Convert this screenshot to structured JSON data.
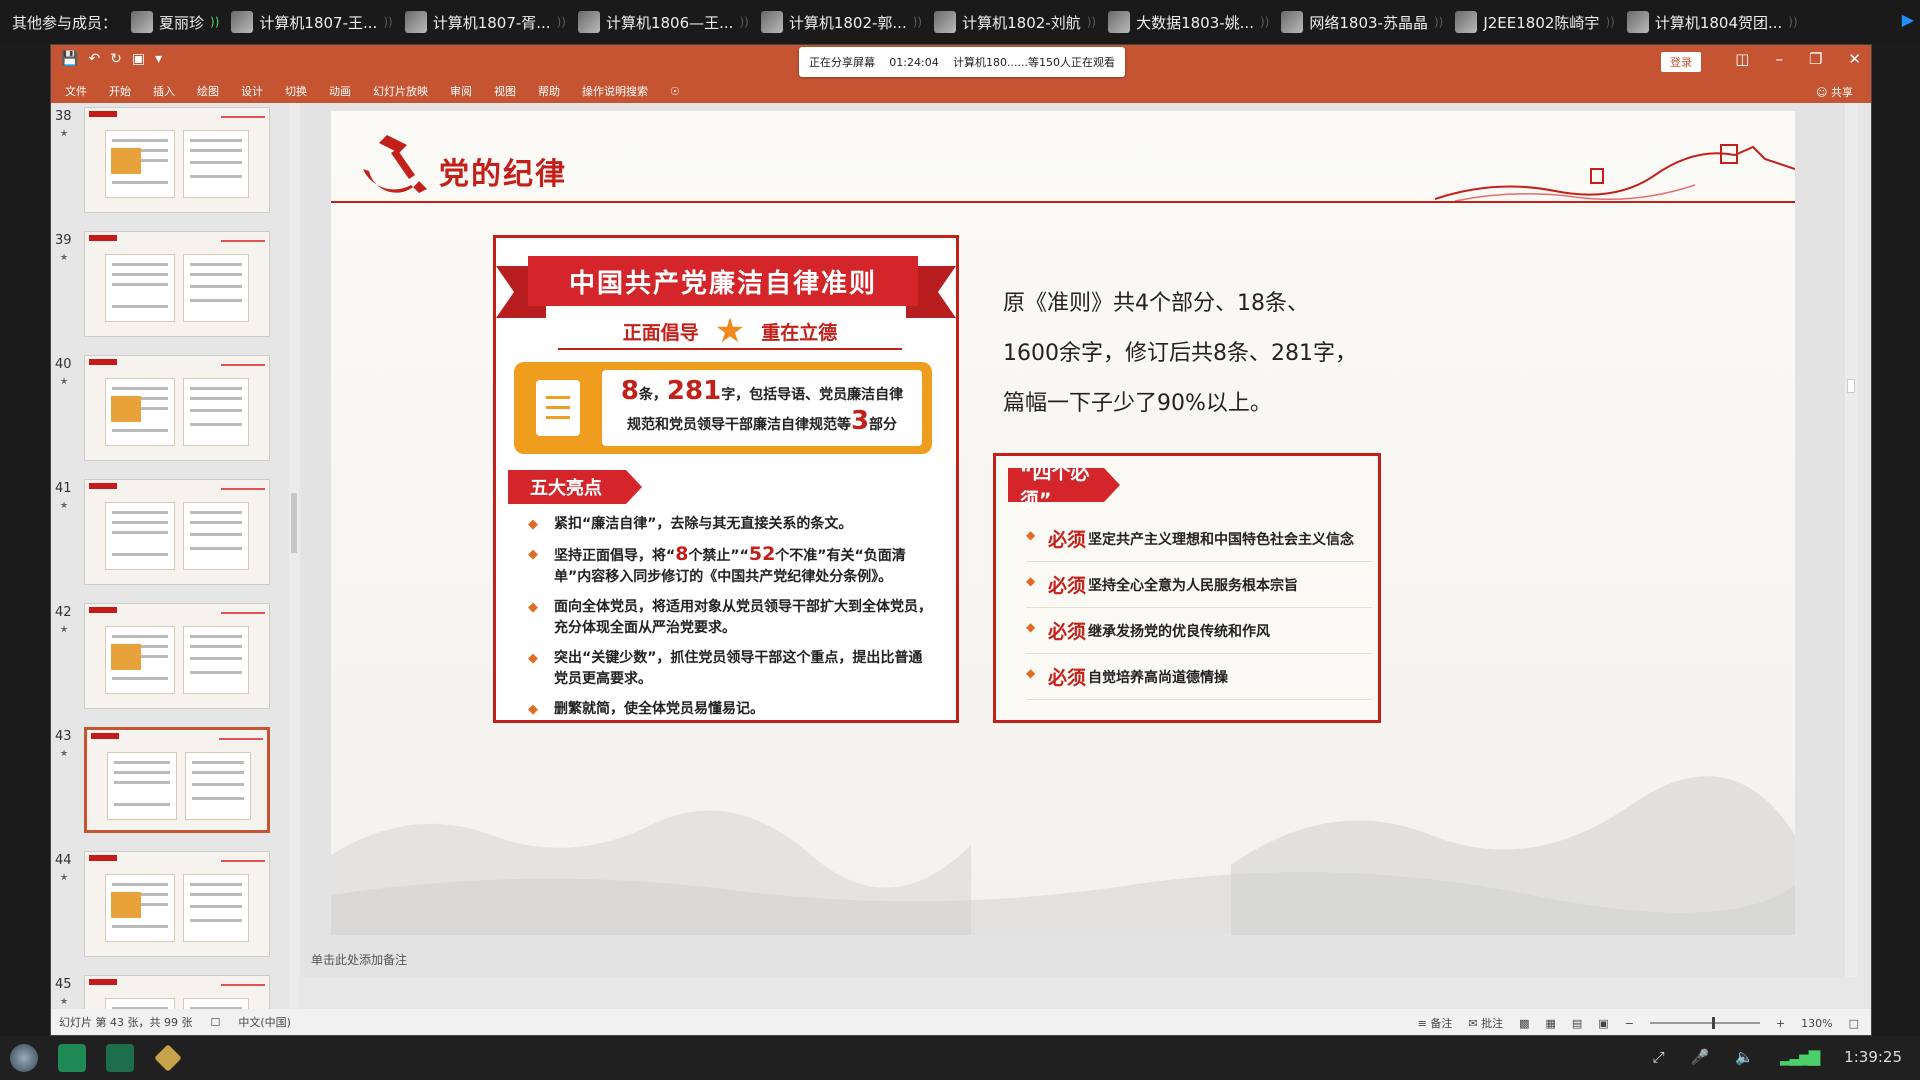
{
  "participants": {
    "label": "其他参与成员：",
    "people": [
      {
        "name": "夏丽珍",
        "speaking": true
      },
      {
        "name": "计算机1807-王...",
        "speaking": false
      },
      {
        "name": "计算机1807-胥...",
        "speaking": false
      },
      {
        "name": "计算机1806—王...",
        "speaking": false
      },
      {
        "name": "计算机1802-郭...",
        "speaking": false
      },
      {
        "name": "计算机1802-刘航",
        "speaking": false
      },
      {
        "name": "大数据1803-姚...",
        "speaking": false
      },
      {
        "name": "网络1803-苏晶晶",
        "speaking": false
      },
      {
        "name": "J2EE1802陈崎宇",
        "speaking": false
      },
      {
        "name": "计算机1804贺团...",
        "speaking": false
      }
    ]
  },
  "share_banner": {
    "status": "正在分享屏幕",
    "time": "01:24:04",
    "viewers": "计算机180......等150人正在观看"
  },
  "window": {
    "login": "登录",
    "share": "共享",
    "ribbon_tabs": [
      "文件",
      "开始",
      "插入",
      "绘图",
      "设计",
      "切换",
      "动画",
      "幻灯片放映",
      "审阅",
      "视图",
      "帮助",
      "操作说明搜索"
    ]
  },
  "thumbnails": [
    {
      "num": "38",
      "selected": false
    },
    {
      "num": "39",
      "selected": false
    },
    {
      "num": "40",
      "selected": false
    },
    {
      "num": "41",
      "selected": false
    },
    {
      "num": "42",
      "selected": false
    },
    {
      "num": "43",
      "selected": true
    },
    {
      "num": "44",
      "selected": false
    },
    {
      "num": "45",
      "selected": false
    }
  ],
  "slide": {
    "title": "党的纪律",
    "banner": "中国共产党廉洁自律准则",
    "subtitle_left": "正面倡导",
    "subtitle_right": "重在立德",
    "summary": {
      "n1": "8",
      "t1": "条，",
      "n2": "281",
      "t2": "字，包括导语、党员廉洁自律",
      "t3": "规范和党员领导干部廉洁自律规范等",
      "n3": "3",
      "t4": "部分"
    },
    "highlights_label": "五大亮点",
    "highlights": [
      {
        "text": "紧扣“廉洁自律”，去除与其无直接关系的条文。"
      },
      {
        "a": "坚持正面倡导，将“",
        "n1": "8",
        "b": "个禁止”“",
        "n2": "52",
        "c": "个不准”有关“负面清单”内容移入同步修订的《中国共产党纪律处分条例》。"
      },
      {
        "text": "面向全体党员，将适用对象从党员领导干部扩大到全体党员，充分体现全面从严治党要求。"
      },
      {
        "text": "突出“关键少数”，抓住党员领导干部这个重点，提出比普通党员更高要求。"
      },
      {
        "text": "删繁就简，使全体党员易懂易记。"
      }
    ],
    "right_text": [
      "原《准则》共4个部分、18条、",
      "1600余字，修订后共8条、281字，",
      "篇幅一下子少了90%以上。"
    ],
    "musts_label": "“四个必须”",
    "musts": [
      {
        "mark": "必须",
        "text": "坚定共产主义理想和中国特色社会主义信念"
      },
      {
        "mark": "必须",
        "text": "坚持全心全意为人民服务根本宗旨"
      },
      {
        "mark": "必须",
        "text": "继承发扬党的优良传统和作风"
      },
      {
        "mark": "必须",
        "text": "自觉培养高尚道德情操"
      }
    ]
  },
  "notes_placeholder": "单击此处添加备注",
  "statusbar": {
    "slide_info": "幻灯片 第 43 张，共 99 张",
    "language": "中文(中国)",
    "notes_btn": "备注",
    "comments_btn": "批注",
    "zoom": "130%"
  },
  "taskbar": {
    "clock": "1:39:25"
  },
  "colors": {
    "ppt_accent": "#c55432",
    "party_red": "#c4201a",
    "orange": "#ef9d1f"
  }
}
